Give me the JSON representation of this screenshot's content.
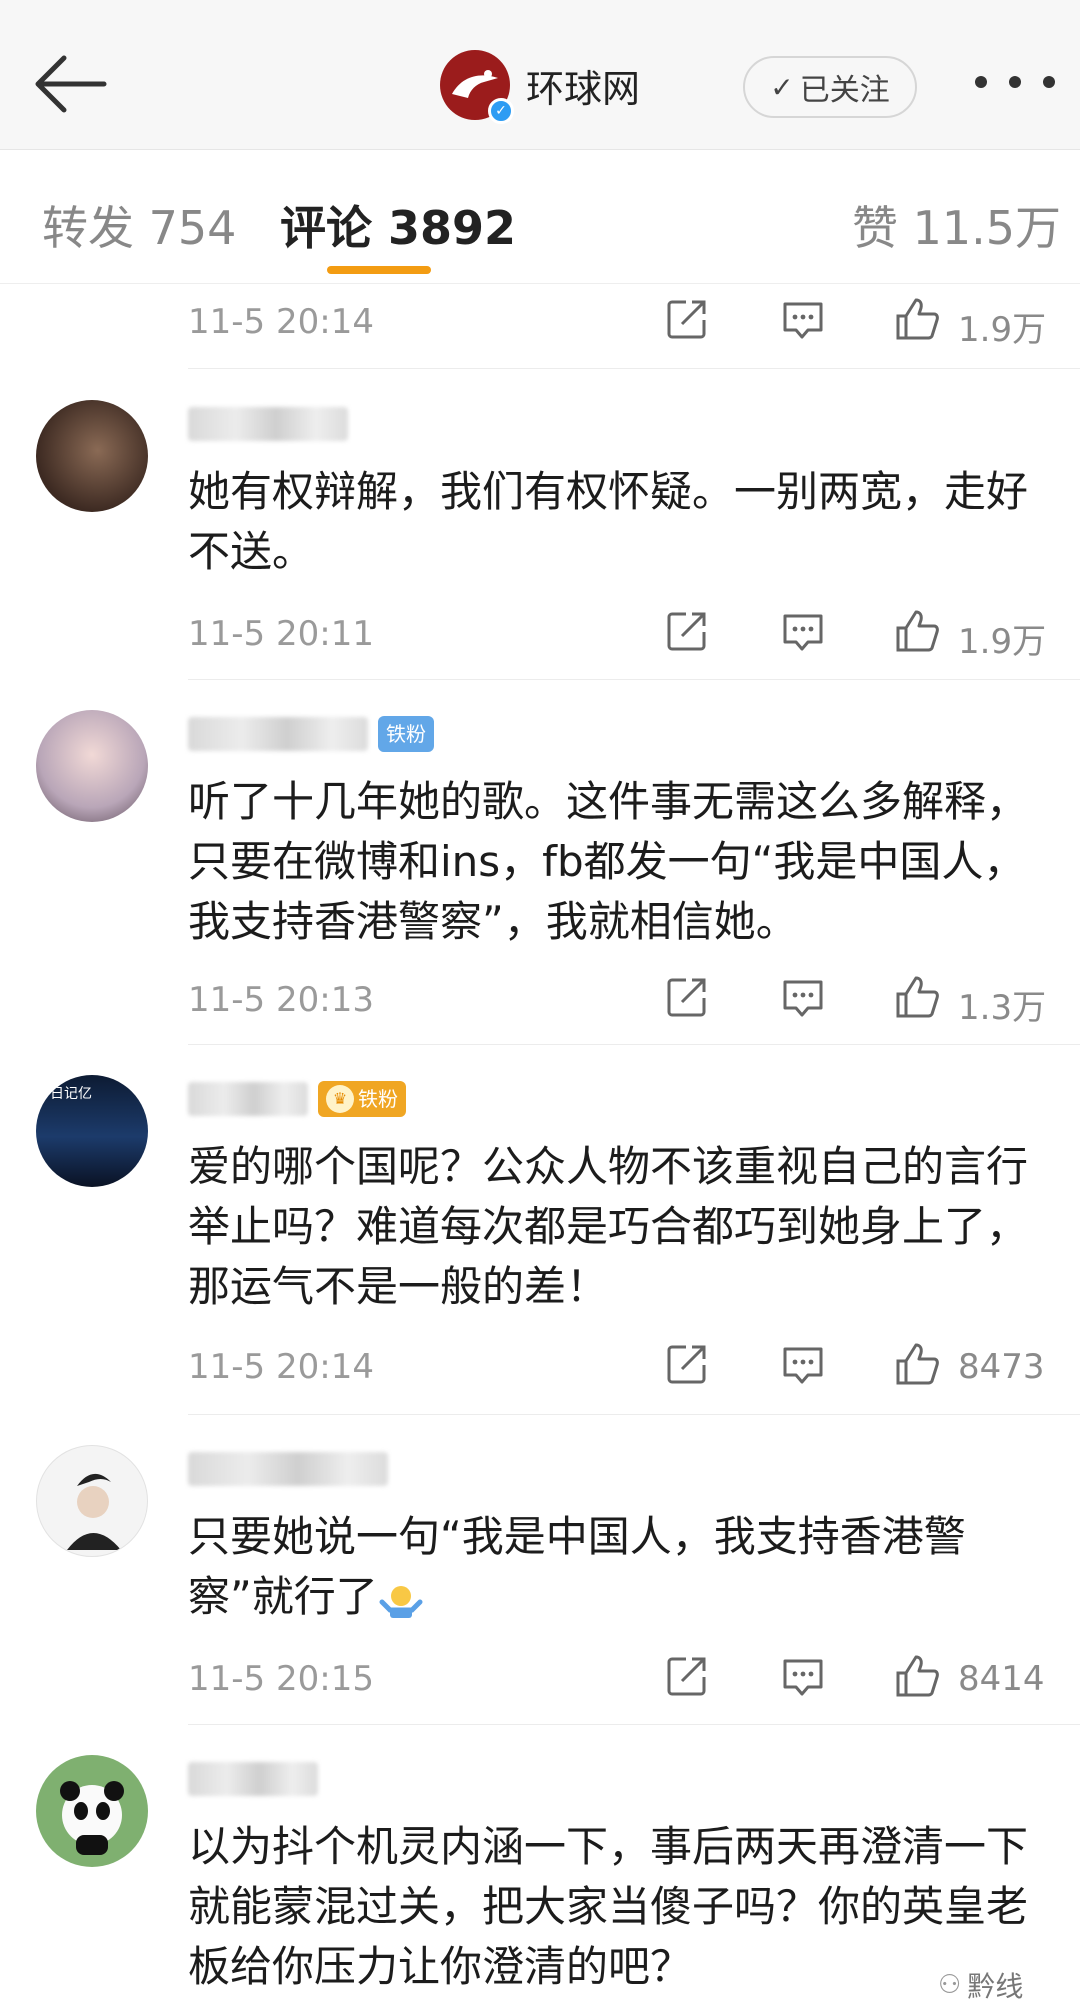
{
  "header": {
    "account_name": "环球网",
    "follow_label": "已关注"
  },
  "tabs": [
    {
      "label": "转发 754"
    },
    {
      "label": "评论 3892"
    },
    {
      "label": "赞 11.5万"
    }
  ],
  "comments": [
    {
      "text": "",
      "time": "11-5 20:14",
      "likes": "1.9万"
    },
    {
      "text": "她有权辩解，我们有权怀疑。一别两宽，走好不送。",
      "time": "11-5 20:11",
      "likes": "1.9万"
    },
    {
      "text": "听了十几年她的歌。这件事无需这么多解释，只要在微博和ins，fb都发一句“我是中国人，我支持香港警察”，我就相信她。",
      "time": "11-5 20:13",
      "likes": "1.3万",
      "badge": "铁粉"
    },
    {
      "text": "爱的哪个国呢？公众人物不该重视自己的言行举止吗？难道每次都是巧合都巧到她身上了，那运气不是一般的差！",
      "time": "11-5 20:14",
      "likes": "8473",
      "badge": "铁粉",
      "avatar_text": "日记亿"
    },
    {
      "text": "只要她说一句“我是中国人，我支持香港警察”就行了",
      "time": "11-5 20:15",
      "likes": "8414"
    },
    {
      "text": "以为抖个机灵内涵一下，事后两天再澄清一下就能蒙混过关，把大家当傻子吗？你的英皇老板给你压力让你澄清的吧？"
    }
  ],
  "watermark": "黔线",
  "colors": {
    "accent": "#f39c12",
    "fan_blue": "#62a7e8",
    "fan_gold": "#f0a623",
    "brand_red": "#9b1c1c"
  }
}
